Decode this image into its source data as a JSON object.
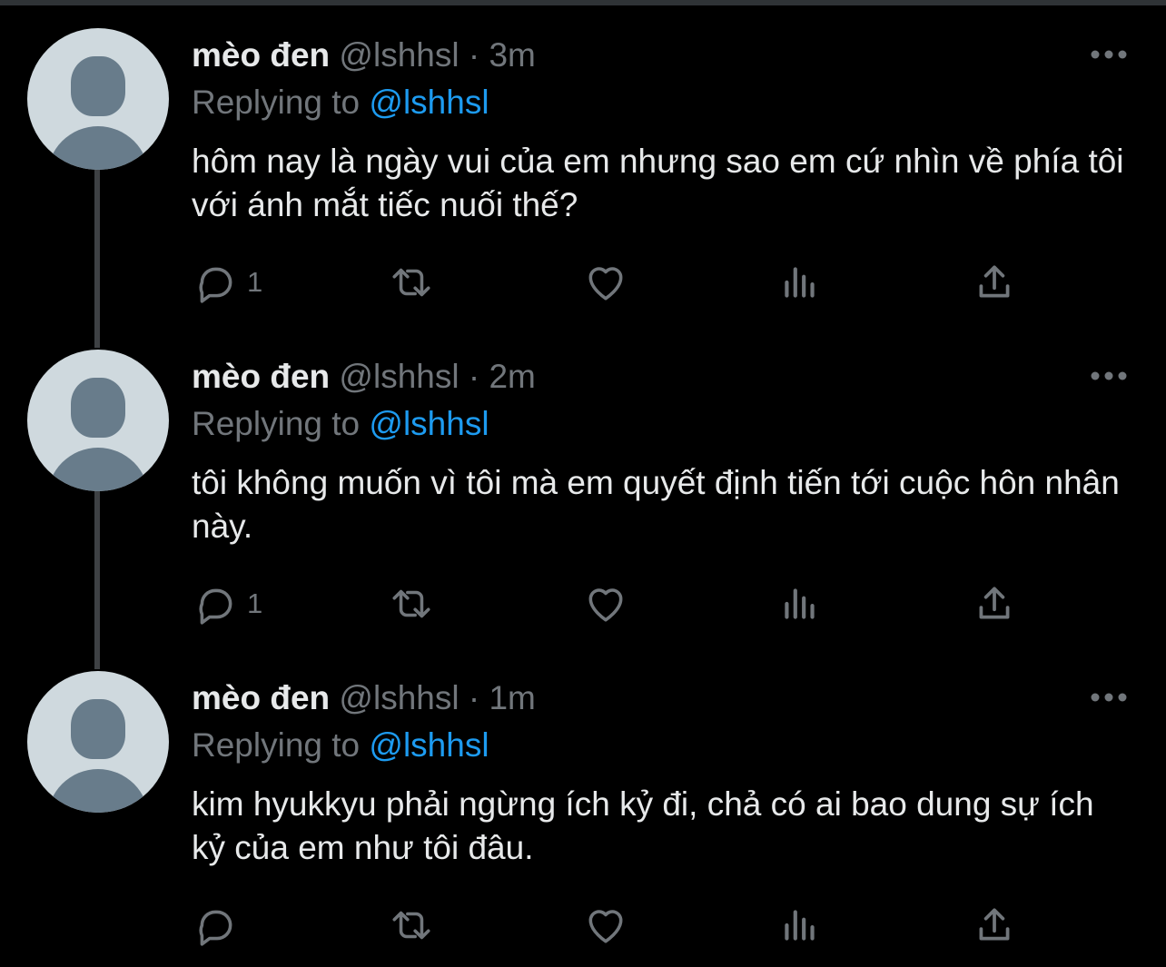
{
  "tweets": [
    {
      "name": "mèo đen",
      "handle": "@lshhsl",
      "separator": "·",
      "time": "3m",
      "replying_prefix": "Replying to",
      "replying_handle": "@lshhsl",
      "text": "hôm nay là ngày vui của em nhưng sao em cứ nhìn về phía tôi với ánh mắt tiếc nuối thế?",
      "reply_count": "1"
    },
    {
      "name": "mèo đen",
      "handle": "@lshhsl",
      "separator": "·",
      "time": "2m",
      "replying_prefix": "Replying to",
      "replying_handle": "@lshhsl",
      "text": "tôi không muốn vì tôi mà em quyết định tiến tới cuộc hôn nhân này.",
      "reply_count": "1"
    },
    {
      "name": "mèo đen",
      "handle": "@lshhsl",
      "separator": "·",
      "time": "1m",
      "replying_prefix": "Replying to",
      "replying_handle": "@lshhsl",
      "text": "kim hyukkyu phải ngừng ích kỷ đi, chả có ai bao dung sự ích kỷ của em như tôi đâu.",
      "reply_count": ""
    }
  ],
  "icons": {
    "reply": "reply-icon",
    "retweet": "retweet-icon",
    "like": "like-icon",
    "analytics": "analytics-icon",
    "share": "share-icon",
    "more": "more-icon"
  },
  "colors": {
    "background": "#000000",
    "text": "#e7e9ea",
    "muted": "#71767b",
    "link": "#1d9bf0",
    "thread_line": "#3e4144"
  }
}
